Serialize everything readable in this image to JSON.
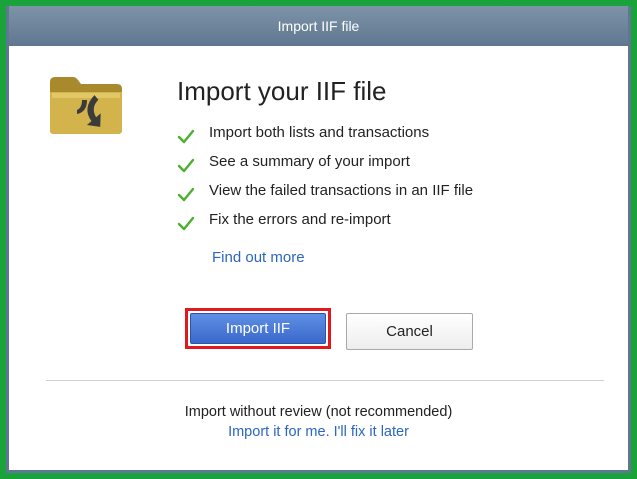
{
  "window": {
    "title": "Import IIF file"
  },
  "icons": {
    "header_icon": "folder-import-icon",
    "bullet_icon": "checkmark-icon"
  },
  "colors": {
    "frame_border": "#1aa33a",
    "titlebar": "#5f7790",
    "checkmark": "#4caf2e",
    "link": "#2a66c2",
    "primary_button": "#3a68cc",
    "highlight": "#e0191f"
  },
  "main": {
    "heading": "Import your IIF file",
    "features": [
      "Import both lists and transactions",
      "See a summary of your import",
      "View the failed transactions in an IIF file",
      "Fix the errors and re-import"
    ],
    "find_out_more": "Find out more"
  },
  "buttons": {
    "import_label": "Import IIF",
    "cancel_label": "Cancel"
  },
  "footer": {
    "no_review_text": "Import without review (not recommended)",
    "fix_later_link": "Import it for me. I'll fix it later"
  }
}
